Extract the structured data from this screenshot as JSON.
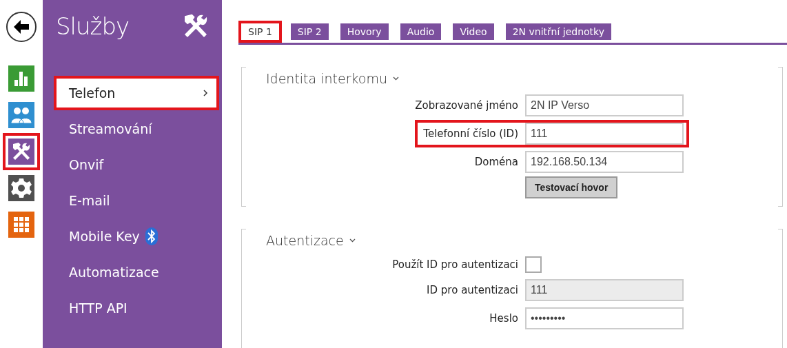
{
  "rail": {
    "items": [
      {
        "kind": "back",
        "highlighted": false
      },
      {
        "kind": "chart",
        "color": "#3a9b35",
        "highlighted": false
      },
      {
        "kind": "users",
        "color": "#2f8fd0",
        "highlighted": false
      },
      {
        "kind": "tools",
        "color": "#7b4f9d",
        "highlighted": true
      },
      {
        "kind": "gear",
        "color": "#505050",
        "highlighted": false
      },
      {
        "kind": "grid",
        "color": "#e4640f",
        "highlighted": false
      }
    ]
  },
  "sidebar": {
    "title": "Služby",
    "items": [
      {
        "kind": "plain",
        "label": "Telefon",
        "selected": true,
        "highlighted": true
      },
      {
        "kind": "plain",
        "label": "Streamování",
        "selected": false,
        "highlighted": false
      },
      {
        "kind": "plain",
        "label": "Onvif",
        "selected": false,
        "highlighted": false
      },
      {
        "kind": "plain",
        "label": "E-mail",
        "selected": false,
        "highlighted": false
      },
      {
        "kind": "bluetooth",
        "label": "Mobile Key",
        "selected": false,
        "highlighted": false
      },
      {
        "kind": "plain",
        "label": "Automatizace",
        "selected": false,
        "highlighted": false
      },
      {
        "kind": "plain",
        "label": "HTTP API",
        "selected": false,
        "highlighted": false
      }
    ]
  },
  "tabs": [
    {
      "label": "SIP 1",
      "selected": true,
      "highlighted": true
    },
    {
      "label": "SIP 2",
      "selected": false,
      "highlighted": false
    },
    {
      "label": "Hovory",
      "selected": false,
      "highlighted": false
    },
    {
      "label": "Audio",
      "selected": false,
      "highlighted": false
    },
    {
      "label": "Video",
      "selected": false,
      "highlighted": false
    },
    {
      "label": "2N vnitřní jednotky",
      "selected": false,
      "highlighted": false
    }
  ],
  "sections": [
    {
      "title": "Identita interkomu",
      "expanded": true,
      "fields": [
        {
          "kind": "text",
          "label": "Zobrazované jméno",
          "value": "2N IP Verso",
          "disabled": false,
          "highlighted": false
        },
        {
          "kind": "text",
          "label": "Telefonní číslo (ID)",
          "value": "111",
          "disabled": false,
          "highlighted": true
        },
        {
          "kind": "text",
          "label": "Doména",
          "value": "192.168.50.134",
          "disabled": false,
          "highlighted": false
        },
        {
          "kind": "button",
          "label": "Testovací hovor"
        }
      ]
    },
    {
      "title": "Autentizace",
      "expanded": true,
      "fields": [
        {
          "kind": "checkbox",
          "label": "Použít ID pro autentizaci",
          "checked": false
        },
        {
          "kind": "text",
          "label": "ID pro autentizaci",
          "value": "111",
          "disabled": true,
          "highlighted": false
        },
        {
          "kind": "text",
          "label": "Heslo",
          "value": "•••••••••",
          "disabled": false,
          "highlighted": false
        }
      ]
    }
  ]
}
